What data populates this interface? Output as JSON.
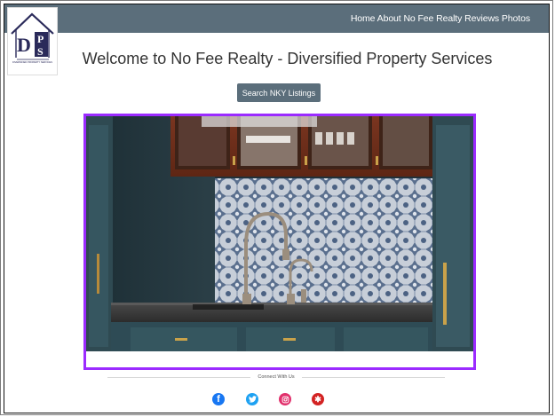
{
  "nav": {
    "items": [
      "Home",
      "About",
      "No Fee Realty",
      "Reviews",
      "Photos"
    ]
  },
  "logo": {
    "letters": "DPS",
    "tagline": "DIVERSIFIED PROPERTY SERVICES"
  },
  "header": {
    "title": "Welcome to No Fee Realty - Diversified Property Services"
  },
  "search_button": {
    "label": "Search NKY Listings"
  },
  "hero": {
    "description": "Kitchen with dark teal cabinets, patterned tile backsplash, brass faucet and hardware"
  },
  "footer": {
    "connect_label": "Connect With Us",
    "social": [
      {
        "name": "facebook",
        "glyph": "f",
        "color": "#1877f2"
      },
      {
        "name": "twitter",
        "glyph": "t",
        "color": "#1da1f2"
      },
      {
        "name": "instagram",
        "glyph": "◎",
        "color": "#e1306c"
      },
      {
        "name": "yelp",
        "glyph": "✱",
        "color": "#d32323"
      }
    ]
  },
  "colors": {
    "topbar": "#5b6e7b",
    "accent_border": "#9b2bff",
    "logo_navy": "#2a2a5a"
  }
}
